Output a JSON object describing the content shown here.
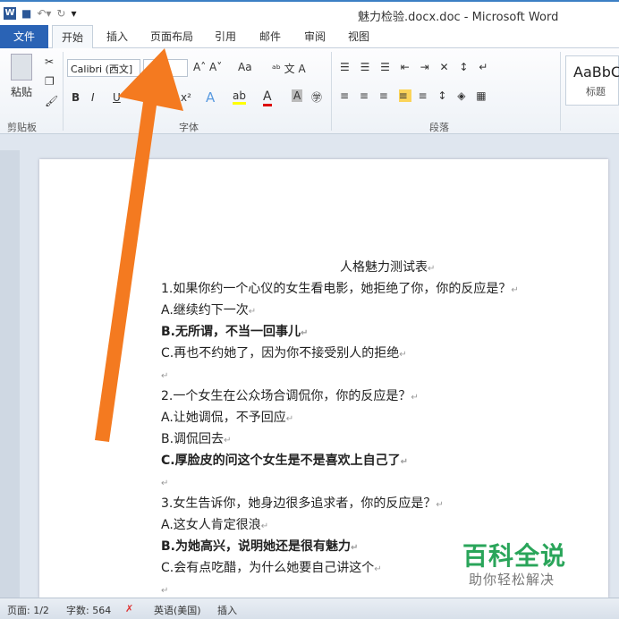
{
  "window": {
    "title": "魅力检验.docx.doc - Microsoft Word",
    "app_icon": "W"
  },
  "tabs": [
    "文件",
    "开始",
    "插入",
    "页面布局",
    "引用",
    "邮件",
    "审阅",
    "视图"
  ],
  "ribbon": {
    "clipboard_label": "剪贴板",
    "paste_label": "粘贴",
    "font_name": "Calibri (西文]",
    "font_group": "字体",
    "paragraph_group": "段落",
    "style_preview": "AaBbC",
    "style_name": "标题",
    "change_case": "Aa",
    "bold": "B",
    "italic": "I",
    "underline": "U"
  },
  "document": {
    "lines": [
      {
        "text": "人格魅力测试表",
        "bold": false,
        "center": true
      },
      {
        "text": "1.如果你约一个心仪的女生看电影，她拒绝了你，你的反应是？",
        "bold": false
      },
      {
        "text": "A.继续约下一次",
        "bold": false
      },
      {
        "text": "B.无所谓，不当一回事儿",
        "bold": true
      },
      {
        "text": "C.再也不约她了，因为你不接受别人的拒绝",
        "bold": false
      },
      {
        "text": "",
        "bold": false
      },
      {
        "text": "2.一个女生在公众场合调侃你，你的反应是？",
        "bold": false
      },
      {
        "text": "A.让她调侃，不予回应",
        "bold": false
      },
      {
        "text": "B.调侃回去",
        "bold": false
      },
      {
        "text": "C.厚脸皮的问这个女生是不是喜欢上自己了",
        "bold": true
      },
      {
        "text": "",
        "bold": false
      },
      {
        "text": "3.女生告诉你，她身边很多追求者，你的反应是？",
        "bold": false
      },
      {
        "text": "A.这女人肯定很浪",
        "bold": false
      },
      {
        "text": "B.为她高兴，说明她还是很有魅力",
        "bold": true
      },
      {
        "text": "C.会有点吃醋，为什么她要自己讲这个",
        "bold": false
      },
      {
        "text": "",
        "bold": false
      }
    ]
  },
  "status": {
    "page": "页面: 1/2",
    "words": "字数: 564",
    "language": "英语(美国)",
    "mode": "插入"
  },
  "watermark": {
    "brand": "百科全说",
    "slogan": "助你轻松解决"
  },
  "colors": {
    "arrow": "#f47a20",
    "file_tab": "#2a63b5",
    "watermark": "#2aa55a"
  }
}
